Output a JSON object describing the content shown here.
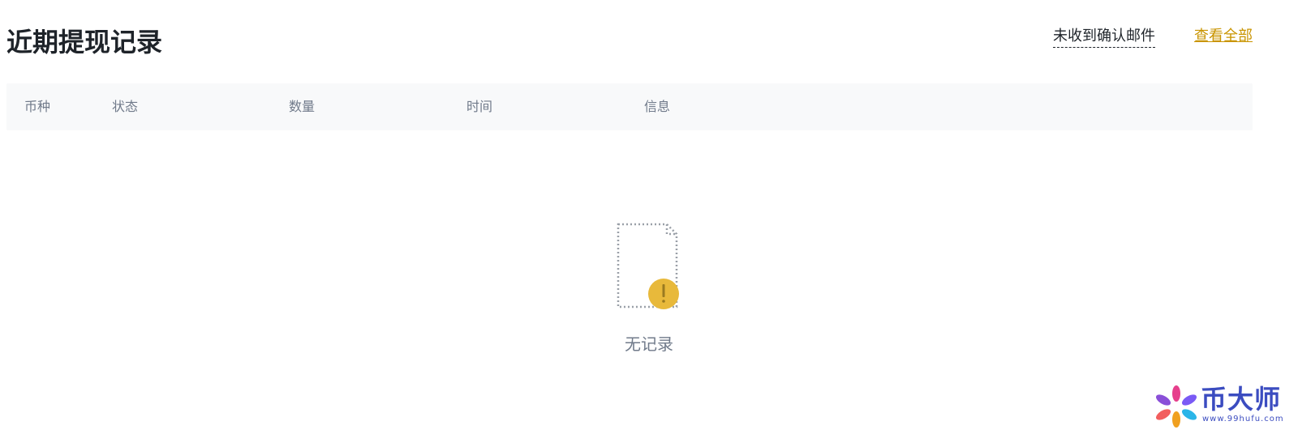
{
  "header": {
    "title": "近期提现记录",
    "no_email_link": "未收到确认邮件",
    "view_all_link": "查看全部"
  },
  "table": {
    "columns": [
      "币种",
      "状态",
      "数量",
      "时间",
      "信息"
    ]
  },
  "empty_state": {
    "message": "无记录",
    "icon": "empty-document-warning-icon"
  },
  "watermark": {
    "name": "币大师",
    "url": "www.99hufu.com"
  },
  "colors": {
    "title": "#1e2329",
    "link_accent": "#c99400",
    "muted_text": "#707a8a",
    "table_header_bg": "#f8f9fa",
    "warning_badge": "#e8b93b"
  }
}
